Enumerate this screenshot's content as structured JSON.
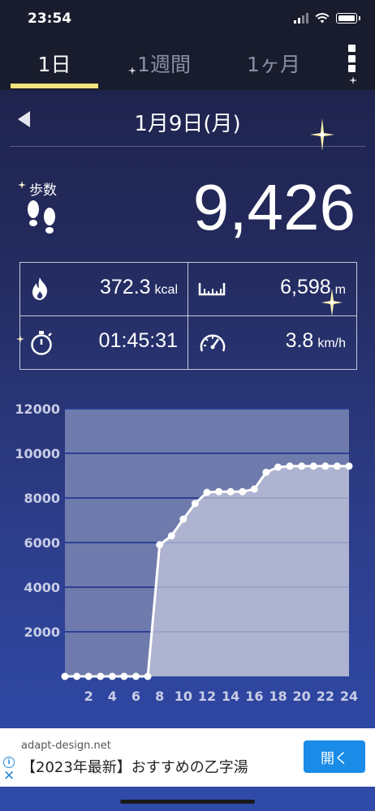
{
  "status_bar": {
    "time": "23:54"
  },
  "tabs": [
    {
      "label": "1日",
      "active": true
    },
    {
      "label": "1週間",
      "active": false
    },
    {
      "label": "1ヶ月",
      "active": false
    }
  ],
  "date": {
    "label": "1月9日(月)"
  },
  "steps": {
    "title": "歩数",
    "value": "9,426"
  },
  "stats": {
    "calories": {
      "value": "372.3",
      "unit": "kcal",
      "icon": "flame-icon"
    },
    "distance": {
      "value": "6,598",
      "unit": "m",
      "icon": "ruler-icon"
    },
    "duration": {
      "value": "01:45:31",
      "icon": "stopwatch-icon"
    },
    "speed": {
      "value": "3.8",
      "unit": "km/h",
      "icon": "speedometer-icon"
    }
  },
  "chart_data": {
    "type": "area",
    "x": [
      0,
      1,
      2,
      3,
      4,
      5,
      6,
      7,
      8,
      9,
      10,
      11,
      12,
      13,
      14,
      15,
      16,
      17,
      18,
      19,
      20,
      21,
      22,
      23,
      24
    ],
    "values": [
      0,
      0,
      0,
      0,
      0,
      0,
      0,
      0,
      5900,
      6300,
      7050,
      7750,
      8250,
      8280,
      8280,
      8280,
      8400,
      9150,
      9380,
      9426,
      9426,
      9426,
      9426,
      9426,
      9426
    ],
    "x_tick_labels": [
      "2",
      "4",
      "6",
      "8",
      "10",
      "12",
      "14",
      "16",
      "18",
      "20",
      "22",
      "24"
    ],
    "x_tick_values": [
      2,
      4,
      6,
      8,
      10,
      12,
      14,
      16,
      18,
      20,
      22,
      24
    ],
    "y_tick_labels": [
      "2000",
      "4000",
      "6000",
      "8000",
      "10000",
      "12000"
    ],
    "y_tick_values": [
      2000,
      4000,
      6000,
      8000,
      10000,
      12000
    ],
    "xlim": [
      0,
      24
    ],
    "ylim": [
      0,
      12000
    ],
    "grid": true,
    "colors": {
      "line": "#ffffff",
      "fill": "#c2c6dc",
      "plot_bg": "#6f7bac",
      "grid": "#2e3f94"
    }
  },
  "ad": {
    "domain": "adapt-design.net",
    "title": "【2023年最新】おすすめの乙字湯",
    "button": "開く",
    "info_icon": "i",
    "close_icon": "✕"
  }
}
